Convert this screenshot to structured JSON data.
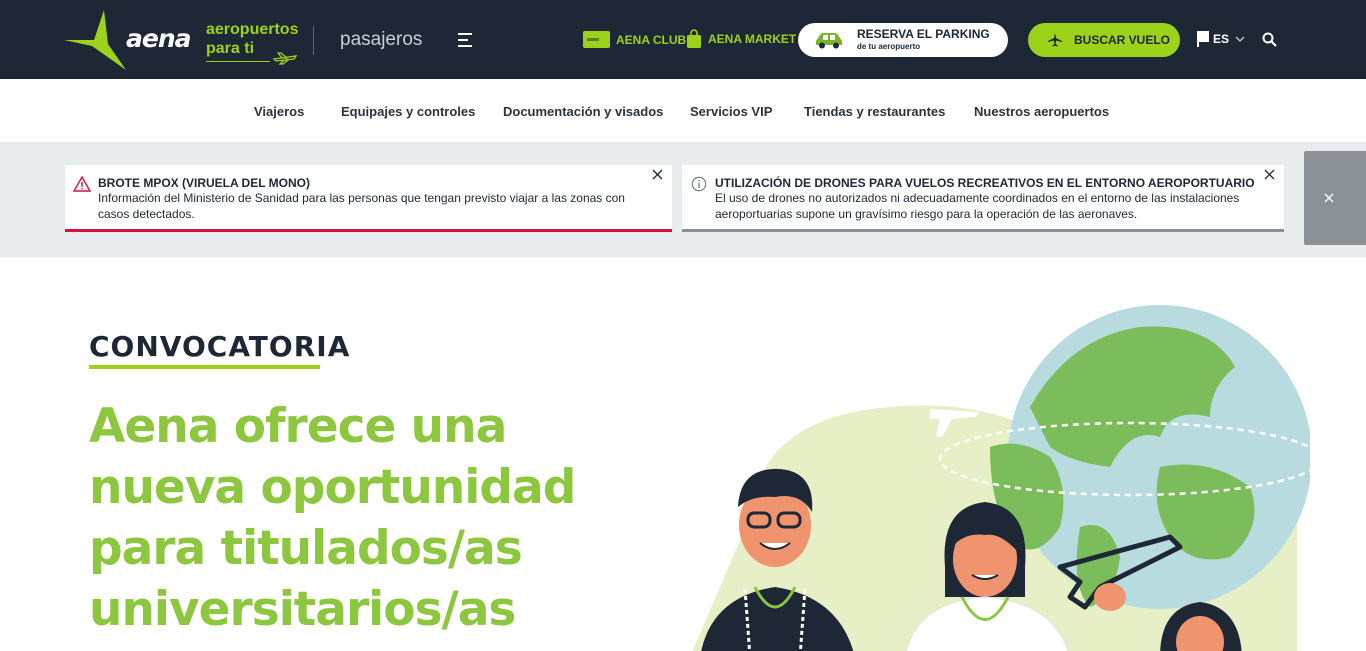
{
  "header": {
    "brand": "aena",
    "tagline_line1": "aeropuertos",
    "tagline_line2": "para ti",
    "section": "pasajeros",
    "club_label": "AENA CLUB",
    "market_label": "AENA MARKET",
    "parking_title": "RESERVA EL PARKING",
    "parking_subtitle": "de tu aeropuerto",
    "flight_button": "BUSCAR VUELO",
    "language": "ES"
  },
  "nav": {
    "items": [
      "Viajeros",
      "Equipajes y controles",
      "Documentación y visados",
      "Servicios VIP",
      "Tiendas y restaurantes",
      "Nuestros aeropuertos"
    ]
  },
  "alerts": [
    {
      "title": "BROTE MPOX (VIRUELA DEL MONO)",
      "body": "Información del Ministerio de Sanidad para las personas que tengan previsto viajar a las zonas con casos detectados.",
      "accent": "#d31145"
    },
    {
      "title": "UTILIZACIÓN DE DRONES PARA VUELOS RECREATIVOS EN EL ENTORNO AEROPORTUARIO",
      "body": "El uso de drones no autorizados ni adecuadamente coordinados en el entorno de las instalaciones aeroportuarias supone un gravísimo riesgo para la operación de las aeronaves.",
      "accent": "#8a9096"
    }
  ],
  "hero": {
    "kicker": "CONVOCATORIA",
    "headline": "Aena ofrece una nueva oportunidad para titulados/as universitarios/as"
  },
  "colors": {
    "header_bg": "#1d2735",
    "brand_green": "#9dd21b",
    "headline_green": "#8dc63f",
    "alert_bar_bg": "#e8ecef"
  }
}
